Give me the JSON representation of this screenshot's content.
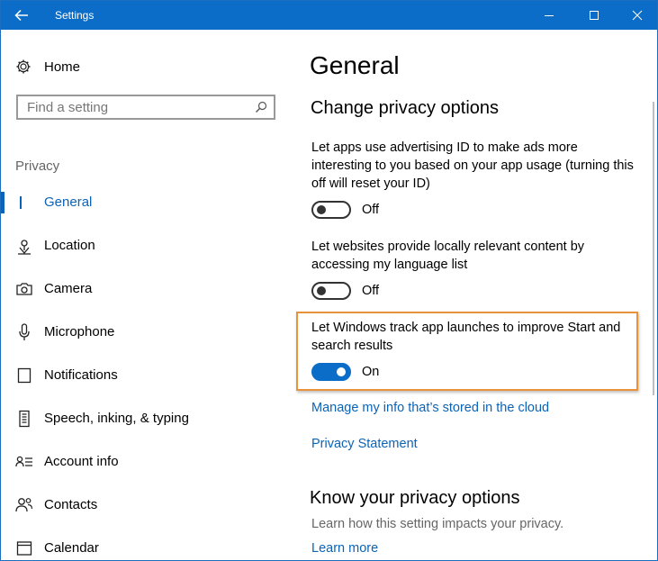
{
  "window": {
    "title": "Settings",
    "accent": "#0b6dc7"
  },
  "sidebar": {
    "home_label": "Home",
    "search_placeholder": "Find a setting",
    "section_label": "Privacy",
    "items": [
      {
        "label": "General",
        "icon": "general-icon",
        "active": true
      },
      {
        "label": "Location",
        "icon": "location-icon"
      },
      {
        "label": "Camera",
        "icon": "camera-icon"
      },
      {
        "label": "Microphone",
        "icon": "microphone-icon"
      },
      {
        "label": "Notifications",
        "icon": "notifications-icon"
      },
      {
        "label": "Speech, inking, & typing",
        "icon": "speech-icon"
      },
      {
        "label": "Account info",
        "icon": "account-info-icon"
      },
      {
        "label": "Contacts",
        "icon": "contacts-icon"
      },
      {
        "label": "Calendar",
        "icon": "calendar-icon"
      }
    ]
  },
  "main": {
    "title": "General",
    "section_title": "Change privacy options",
    "settings": [
      {
        "description": "Let apps use advertising ID to make ads more interesting to you based on your app usage (turning this off will reset your ID)",
        "state": "Off"
      },
      {
        "description": "Let websites provide locally relevant content by accessing my language list",
        "state": "Off"
      },
      {
        "description": "Let Windows track app launches to improve Start and search results",
        "state": "On"
      }
    ],
    "links": {
      "manage": "Manage my info that’s stored in the cloud",
      "privacy_statement": "Privacy Statement"
    },
    "know_title": "Know your privacy options",
    "know_desc": "Learn how this setting impacts your privacy.",
    "learn_more": "Learn more",
    "highlight_color": "#e8923b"
  }
}
